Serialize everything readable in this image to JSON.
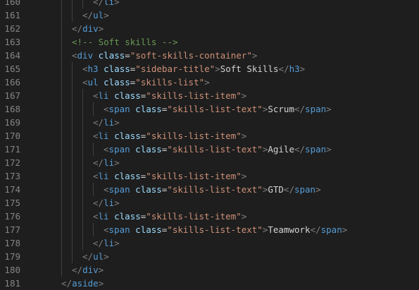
{
  "editor": {
    "colors": {
      "background": "#1e1e1e",
      "gutter": "#858585",
      "punctuation": "#808080",
      "tag": "#569cd6",
      "attribute": "#9cdcfe",
      "string": "#ce9178",
      "text": "#d4d4d4",
      "comment": "#6a9955"
    },
    "lines": [
      {
        "n": "160",
        "indent": 3,
        "tokens": [
          [
            "punc",
            "</"
          ],
          [
            "tag",
            "li"
          ],
          [
            "punc",
            ">"
          ]
        ]
      },
      {
        "n": "161",
        "indent": 2,
        "tokens": [
          [
            "punc",
            "</"
          ],
          [
            "tag",
            "ul"
          ],
          [
            "punc",
            ">"
          ]
        ]
      },
      {
        "n": "162",
        "indent": 1,
        "tokens": [
          [
            "punc",
            "</"
          ],
          [
            "tag",
            "div"
          ],
          [
            "punc",
            ">"
          ]
        ]
      },
      {
        "n": "163",
        "indent": 1,
        "tokens": [
          [
            "comment",
            "<!-- Soft skills -->"
          ]
        ]
      },
      {
        "n": "164",
        "indent": 1,
        "tokens": [
          [
            "punc",
            "<"
          ],
          [
            "tag",
            "div"
          ],
          [
            "text",
            " "
          ],
          [
            "attr",
            "class"
          ],
          [
            "eq",
            "="
          ],
          [
            "str",
            "\"soft-skills-container\""
          ],
          [
            "punc",
            ">"
          ]
        ]
      },
      {
        "n": "165",
        "indent": 2,
        "tokens": [
          [
            "punc",
            "<"
          ],
          [
            "tag",
            "h3"
          ],
          [
            "text",
            " "
          ],
          [
            "attr",
            "class"
          ],
          [
            "eq",
            "="
          ],
          [
            "str",
            "\"sidebar-title\""
          ],
          [
            "punc",
            ">"
          ],
          [
            "text",
            "Soft Skills"
          ],
          [
            "punc",
            "</"
          ],
          [
            "tag",
            "h3"
          ],
          [
            "punc",
            ">"
          ]
        ]
      },
      {
        "n": "166",
        "indent": 2,
        "tokens": [
          [
            "punc",
            "<"
          ],
          [
            "tag",
            "ul"
          ],
          [
            "text",
            " "
          ],
          [
            "attr",
            "class"
          ],
          [
            "eq",
            "="
          ],
          [
            "str",
            "\"skills-list\""
          ],
          [
            "punc",
            ">"
          ]
        ]
      },
      {
        "n": "167",
        "indent": 3,
        "tokens": [
          [
            "punc",
            "<"
          ],
          [
            "tag",
            "li"
          ],
          [
            "text",
            " "
          ],
          [
            "attr",
            "class"
          ],
          [
            "eq",
            "="
          ],
          [
            "str",
            "\"skills-list-item\""
          ],
          [
            "punc",
            ">"
          ]
        ]
      },
      {
        "n": "168",
        "indent": 4,
        "tokens": [
          [
            "punc",
            "<"
          ],
          [
            "tag",
            "span"
          ],
          [
            "text",
            " "
          ],
          [
            "attr",
            "class"
          ],
          [
            "eq",
            "="
          ],
          [
            "str",
            "\"skills-list-text\""
          ],
          [
            "punc",
            ">"
          ],
          [
            "text",
            "Scrum"
          ],
          [
            "punc",
            "</"
          ],
          [
            "tag",
            "span"
          ],
          [
            "punc",
            ">"
          ]
        ]
      },
      {
        "n": "169",
        "indent": 3,
        "tokens": [
          [
            "punc",
            "</"
          ],
          [
            "tag",
            "li"
          ],
          [
            "punc",
            ">"
          ]
        ]
      },
      {
        "n": "170",
        "indent": 3,
        "tokens": [
          [
            "punc",
            "<"
          ],
          [
            "tag",
            "li"
          ],
          [
            "text",
            " "
          ],
          [
            "attr",
            "class"
          ],
          [
            "eq",
            "="
          ],
          [
            "str",
            "\"skills-list-item\""
          ],
          [
            "punc",
            ">"
          ]
        ]
      },
      {
        "n": "171",
        "indent": 4,
        "tokens": [
          [
            "punc",
            "<"
          ],
          [
            "tag",
            "span"
          ],
          [
            "text",
            " "
          ],
          [
            "attr",
            "class"
          ],
          [
            "eq",
            "="
          ],
          [
            "str",
            "\"skills-list-text\""
          ],
          [
            "punc",
            ">"
          ],
          [
            "text",
            "Agile"
          ],
          [
            "punc",
            "</"
          ],
          [
            "tag",
            "span"
          ],
          [
            "punc",
            ">"
          ]
        ]
      },
      {
        "n": "172",
        "indent": 3,
        "tokens": [
          [
            "punc",
            "</"
          ],
          [
            "tag",
            "li"
          ],
          [
            "punc",
            ">"
          ]
        ]
      },
      {
        "n": "173",
        "indent": 3,
        "tokens": [
          [
            "punc",
            "<"
          ],
          [
            "tag",
            "li"
          ],
          [
            "text",
            " "
          ],
          [
            "attr",
            "class"
          ],
          [
            "eq",
            "="
          ],
          [
            "str",
            "\"skills-list-item\""
          ],
          [
            "punc",
            ">"
          ]
        ]
      },
      {
        "n": "174",
        "indent": 4,
        "tokens": [
          [
            "punc",
            "<"
          ],
          [
            "tag",
            "span"
          ],
          [
            "text",
            " "
          ],
          [
            "attr",
            "class"
          ],
          [
            "eq",
            "="
          ],
          [
            "str",
            "\"skills-list-text\""
          ],
          [
            "punc",
            ">"
          ],
          [
            "text",
            "GTD"
          ],
          [
            "punc",
            "</"
          ],
          [
            "tag",
            "span"
          ],
          [
            "punc",
            ">"
          ]
        ]
      },
      {
        "n": "175",
        "indent": 3,
        "tokens": [
          [
            "punc",
            "</"
          ],
          [
            "tag",
            "li"
          ],
          [
            "punc",
            ">"
          ]
        ]
      },
      {
        "n": "176",
        "indent": 3,
        "tokens": [
          [
            "punc",
            "<"
          ],
          [
            "tag",
            "li"
          ],
          [
            "text",
            " "
          ],
          [
            "attr",
            "class"
          ],
          [
            "eq",
            "="
          ],
          [
            "str",
            "\"skills-list-item\""
          ],
          [
            "punc",
            ">"
          ]
        ]
      },
      {
        "n": "177",
        "indent": 4,
        "tokens": [
          [
            "punc",
            "<"
          ],
          [
            "tag",
            "span"
          ],
          [
            "text",
            " "
          ],
          [
            "attr",
            "class"
          ],
          [
            "eq",
            "="
          ],
          [
            "str",
            "\"skills-list-text\""
          ],
          [
            "punc",
            ">"
          ],
          [
            "text",
            "Teamwork"
          ],
          [
            "punc",
            "</"
          ],
          [
            "tag",
            "span"
          ],
          [
            "punc",
            ">"
          ]
        ]
      },
      {
        "n": "178",
        "indent": 3,
        "tokens": [
          [
            "punc",
            "</"
          ],
          [
            "tag",
            "li"
          ],
          [
            "punc",
            ">"
          ]
        ]
      },
      {
        "n": "179",
        "indent": 2,
        "tokens": [
          [
            "punc",
            "</"
          ],
          [
            "tag",
            "ul"
          ],
          [
            "punc",
            ">"
          ]
        ]
      },
      {
        "n": "180",
        "indent": 1,
        "tokens": [
          [
            "punc",
            "</"
          ],
          [
            "tag",
            "div"
          ],
          [
            "punc",
            ">"
          ]
        ]
      },
      {
        "n": "181",
        "indent": 0,
        "tokens": [
          [
            "punc",
            "</"
          ],
          [
            "tag",
            "aside"
          ],
          [
            "punc",
            ">"
          ]
        ]
      }
    ]
  }
}
